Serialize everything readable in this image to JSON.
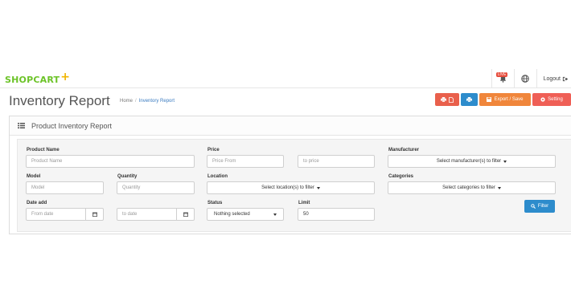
{
  "brand": {
    "name": "SHOPCART",
    "plus": "+"
  },
  "topbar": {
    "notification_badge": "LIVE",
    "logout_label": "Logout"
  },
  "page": {
    "title": "Inventory Report",
    "breadcrumb": [
      "Home",
      "Inventory Report"
    ]
  },
  "actions": {
    "export_label": "Export / Save",
    "setting_label": "Setting"
  },
  "panel": {
    "title": "Product Inventory Report"
  },
  "filters": {
    "product_name": {
      "label": "Product Name",
      "placeholder": "Product Name"
    },
    "price": {
      "label": "Price",
      "from_placeholder": "Price From",
      "to_placeholder": "to price"
    },
    "manufacturer": {
      "label": "Manufacturer",
      "value": "Select manufacturer(s) to filter"
    },
    "model": {
      "label": "Model",
      "placeholder": "Model"
    },
    "quantity": {
      "label": "Quantity",
      "placeholder": "Quantity"
    },
    "location": {
      "label": "Location",
      "value": "Select location(s) to filter"
    },
    "categories": {
      "label": "Categories",
      "value": "Select categories to filter"
    },
    "date_add": {
      "label": "Date add",
      "from_placeholder": "From date",
      "to_placeholder": "to date"
    },
    "status": {
      "label": "Status",
      "value": "Nothing selected"
    },
    "limit": {
      "label": "Limit",
      "value": "50"
    },
    "filter_button": "Filter"
  },
  "colors": {
    "brand_green": "#6cc328",
    "brand_plus": "#f0b400",
    "primary": "#2d8ccc",
    "danger": "#e9604c",
    "warning": "#f0863b"
  }
}
